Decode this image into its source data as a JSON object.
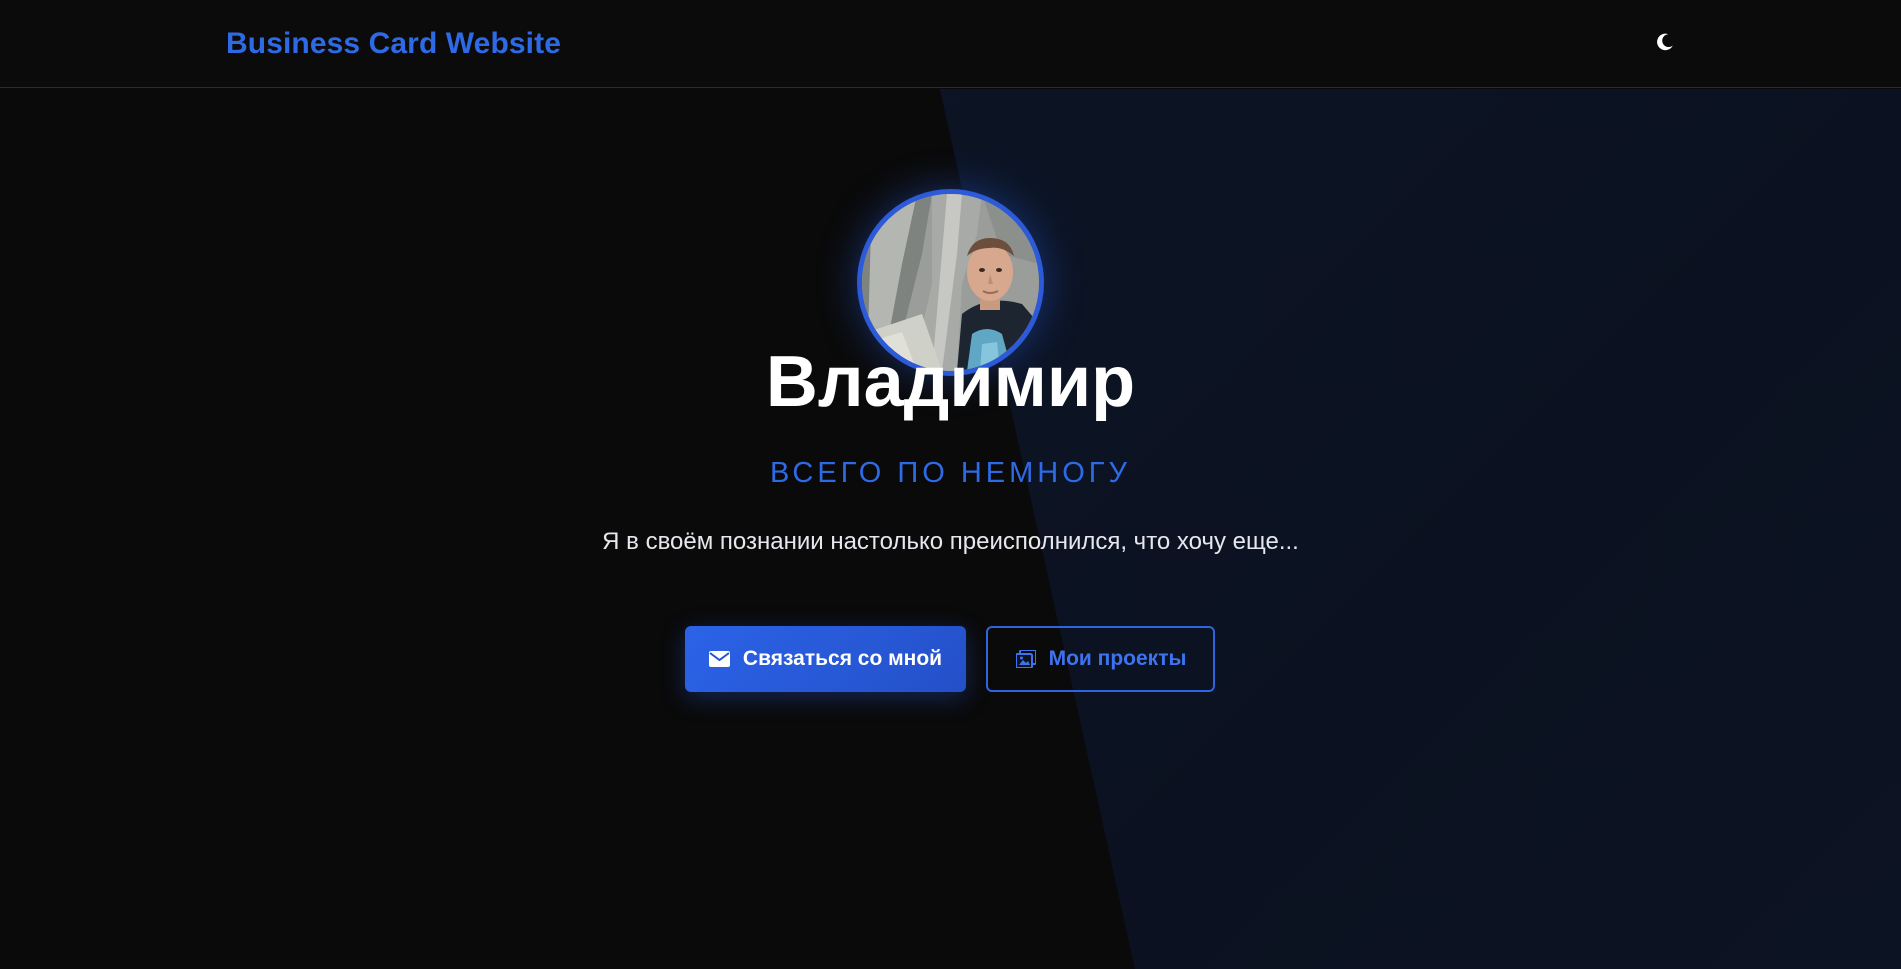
{
  "header": {
    "brand": "Business Card Website",
    "theme_toggle_icon": "moon-icon"
  },
  "hero": {
    "name": "Владимир",
    "subtitle": "ВСЕГО ПО НЕМНОГУ",
    "bio": "Я в своём познании настолько преисполнился, что хочу еще...",
    "buttons": {
      "contact": {
        "label": "Связаться со мной",
        "icon": "envelope-icon"
      },
      "projects": {
        "label": "Мои проекты",
        "icon": "image-gallery-icon"
      }
    }
  },
  "colors": {
    "accent": "#2f6ae6",
    "background": "#0a0a0a",
    "avatar_border": "#2c5ad8"
  }
}
